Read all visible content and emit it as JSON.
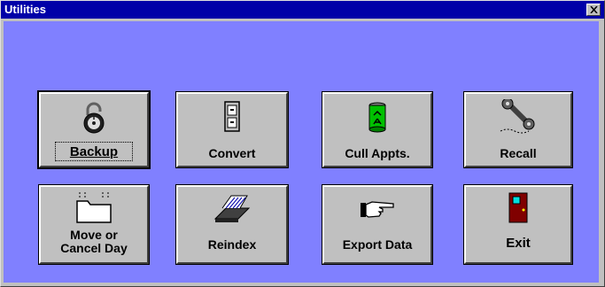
{
  "window": {
    "title": "Utilities",
    "close_label": "Close"
  },
  "buttons": [
    {
      "label": "Backup",
      "icon": "padlock-icon",
      "focused": true
    },
    {
      "label": "Convert",
      "icon": "file-cabinet-icon"
    },
    {
      "label": "Cull Appts.",
      "icon": "recycle-bin-icon"
    },
    {
      "label": "Recall",
      "icon": "telephone-icon"
    },
    {
      "label": "Move or\nCancel Day",
      "icon": "folder-icon"
    },
    {
      "label": "Reindex",
      "icon": "card-file-icon"
    },
    {
      "label": "Export Data",
      "icon": "pointing-hand-icon"
    },
    {
      "label": "Exit",
      "icon": "door-icon"
    }
  ],
  "colors": {
    "titlebar": "#0000a8",
    "client_background": "#8080ff",
    "button_face": "#c0c0c0"
  }
}
